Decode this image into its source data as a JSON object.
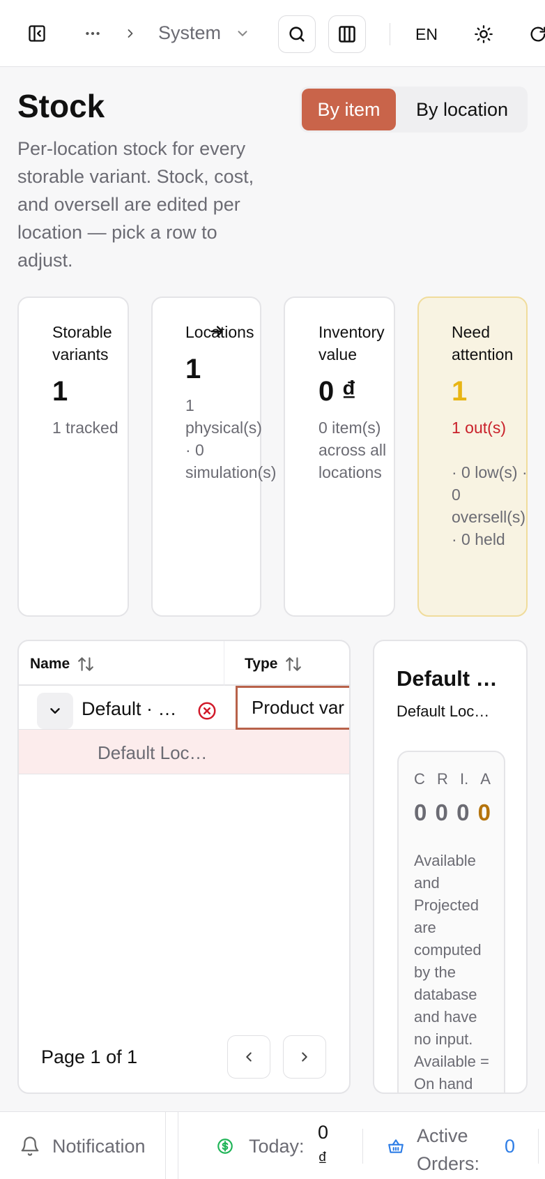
{
  "topbar": {
    "breadcrumb_current": "System",
    "language": "EN"
  },
  "header": {
    "title": "Stock",
    "description": "Per-location stock for every storable variant. Stock, cost, and oversell are edited per location — pick a row to adjust.",
    "view_toggle": {
      "active": "By item",
      "inactive": "By location"
    }
  },
  "stats": [
    {
      "label": "Storable variants",
      "value": "1",
      "sub": "1 tracked"
    },
    {
      "label": "Locations",
      "value": "1",
      "sub": "1 physical(s) · 0 simulation(s)"
    },
    {
      "label": "Inventory value",
      "value": "0 ₫",
      "sub": "0 item(s) across all locations"
    },
    {
      "label": "Need attention",
      "value": "1",
      "sub_alert": "1 out(s)",
      "sub": "· 0 low(s) · 0 oversell(s) · 0 held"
    }
  ],
  "table": {
    "columns": [
      "Name",
      "Type"
    ],
    "rows": [
      {
        "name": "Default · …",
        "type": "Product variant"
      }
    ],
    "child_row": {
      "name": "Default Loc…"
    },
    "pagination": "Page 1 of 1"
  },
  "detail": {
    "title": "Default …",
    "subtitle": "Default Loc…",
    "metric_labels": [
      "C",
      "R",
      "I.",
      "A"
    ],
    "metric_values": [
      "0",
      "0",
      "0",
      "0"
    ],
    "note": "Available and Projected are computed by the database and have no input. Available = On hand"
  },
  "statusbar": {
    "notification": "Notification",
    "today_label": "Today:",
    "today_value": "0",
    "today_currency": "₫",
    "active_orders_label": "Active Orders:",
    "active_orders_value": "0"
  },
  "colors": {
    "accent": "#c9644a",
    "warning": "#e8b514",
    "danger": "#c9202a",
    "link": "#2f7ee6",
    "success": "#1fb457"
  }
}
